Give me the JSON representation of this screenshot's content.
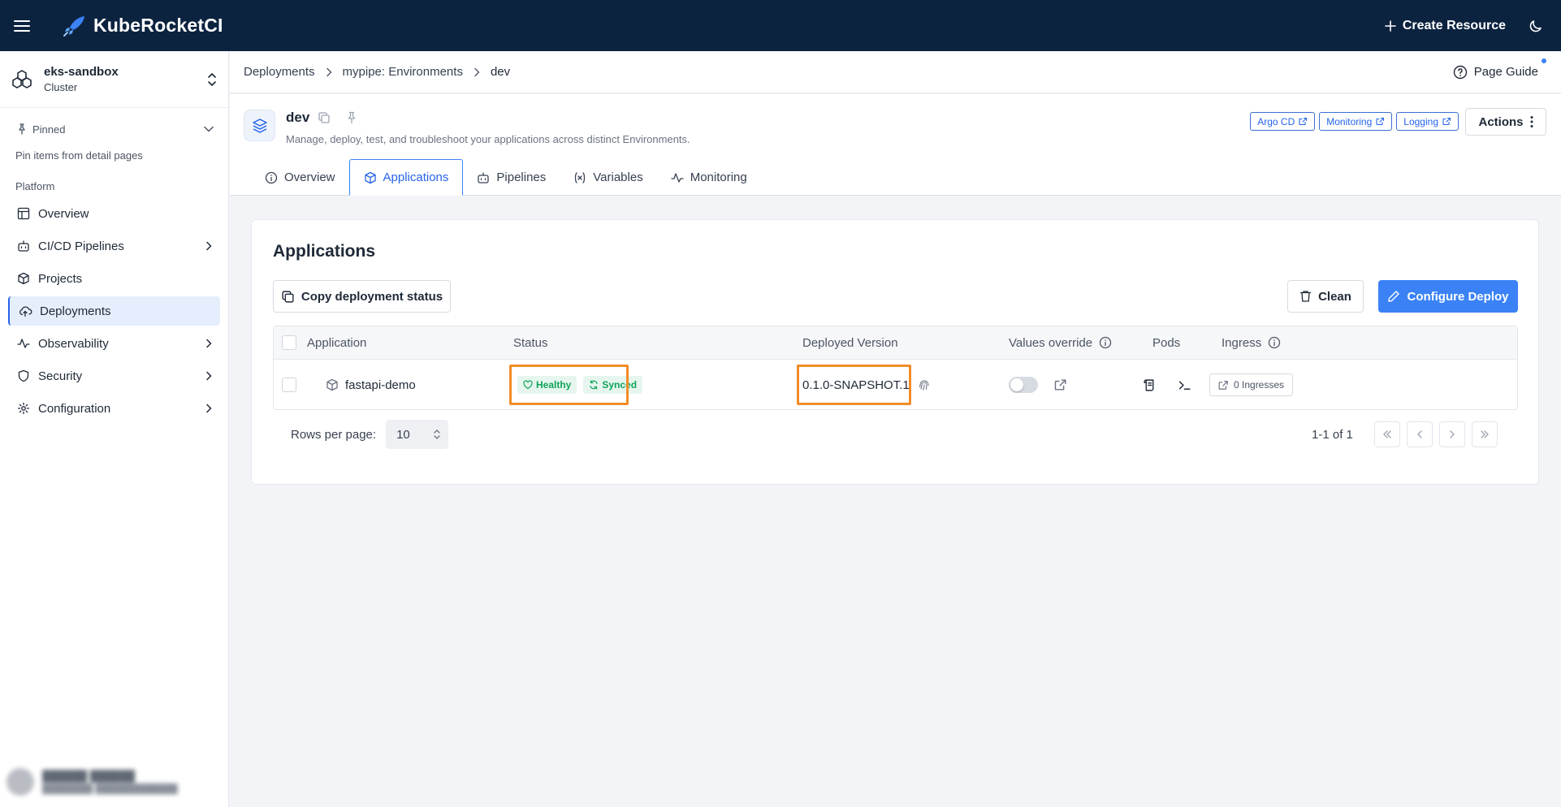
{
  "topbar": {
    "brand": "KubeRocketCI",
    "create_label": "Create Resource"
  },
  "cluster": {
    "name": "eks-sandbox",
    "type": "Cluster"
  },
  "sidebar": {
    "pinned_label": "Pinned",
    "pin_hint": "Pin items from detail pages",
    "section": "Platform",
    "items": [
      {
        "label": "Overview"
      },
      {
        "label": "CI/CD Pipelines"
      },
      {
        "label": "Projects"
      },
      {
        "label": "Deployments"
      },
      {
        "label": "Observability"
      },
      {
        "label": "Security"
      },
      {
        "label": "Configuration"
      }
    ]
  },
  "breadcrumb": {
    "items": [
      "Deployments",
      "mypipe: Environments",
      "dev"
    ]
  },
  "page_guide": "Page Guide",
  "environment": {
    "name": "dev",
    "description": "Manage, deploy, test, and troubleshoot your applications across distinct Environments.",
    "links": [
      "Argo CD",
      "Monitoring",
      "Logging"
    ],
    "actions_label": "Actions"
  },
  "tabs": [
    "Overview",
    "Applications",
    "Pipelines",
    "Variables",
    "Monitoring"
  ],
  "applications": {
    "title": "Applications",
    "copy_label": "Copy deployment status",
    "clean_label": "Clean",
    "configure_label": "Configure Deploy",
    "columns": [
      "Application",
      "Status",
      "Deployed Version",
      "Values override",
      "Pods",
      "Ingress"
    ],
    "rows": [
      {
        "name": "fastapi-demo",
        "health": "Healthy",
        "sync": "Synced",
        "version": "0.1.0-SNAPSHOT.1",
        "ingress": "0 Ingresses"
      }
    ],
    "rows_per_page_label": "Rows per page:",
    "rows_per_page": "10",
    "range": "1-1 of 1"
  },
  "colors": {
    "topbar": "#0c2340",
    "accent": "#3b82f6",
    "success": "#10a35a",
    "highlight": "#f28c28"
  }
}
